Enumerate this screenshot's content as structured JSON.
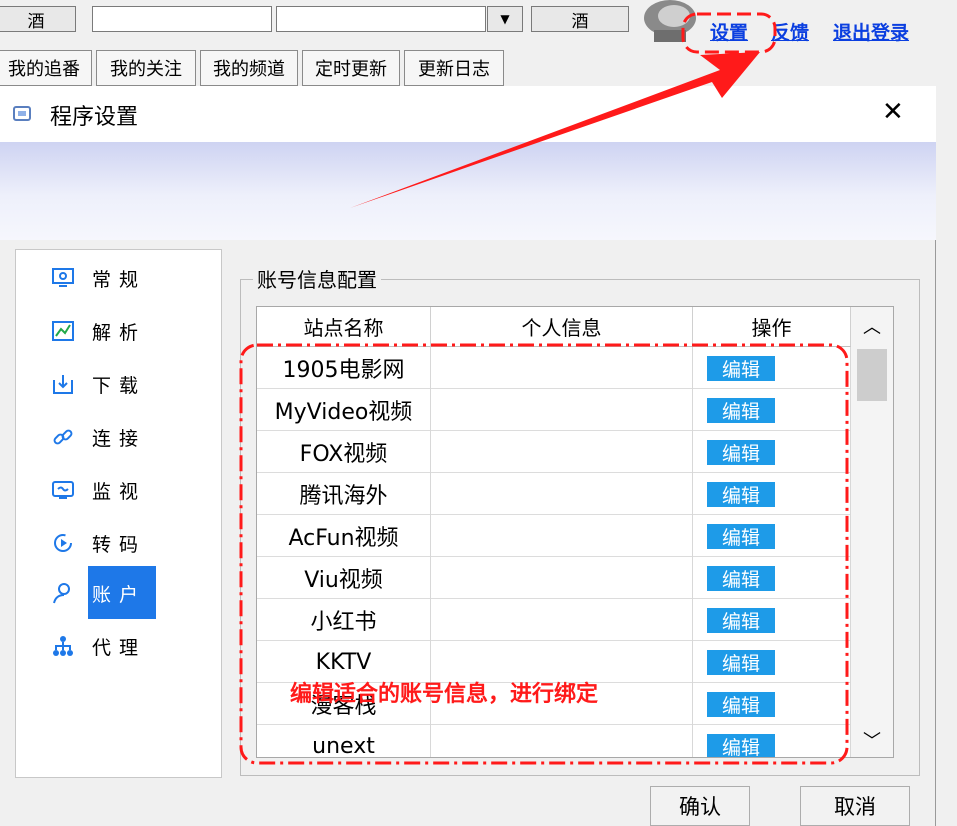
{
  "topbar": {
    "btn_left": "酒",
    "btn_right": "酒",
    "links": [
      "设置",
      "反馈",
      "退出登录"
    ]
  },
  "tabs": [
    "我的追番",
    "我的关注",
    "我的频道",
    "定时更新",
    "更新日志"
  ],
  "dialog": {
    "title": "程序设置",
    "close_glyph": "✕",
    "nav": [
      {
        "label": "常规",
        "icon": "monitor-settings-icon"
      },
      {
        "label": "解析",
        "icon": "chart-icon"
      },
      {
        "label": "下载",
        "icon": "download-icon"
      },
      {
        "label": "连接",
        "icon": "link-icon"
      },
      {
        "label": "监视",
        "icon": "screen-monitor-icon"
      },
      {
        "label": "转码",
        "icon": "convert-icon"
      },
      {
        "label": "账户",
        "icon": "user-icon",
        "selected": true
      },
      {
        "label": "代理",
        "icon": "network-icon"
      }
    ],
    "group_label": "账号信息配置",
    "table": {
      "headers": [
        "站点名称",
        "个人信息",
        "操作"
      ],
      "rows": [
        {
          "site": "1905电影网",
          "info": "",
          "action": "编辑"
        },
        {
          "site": "MyVideo视频",
          "info": "",
          "action": "编辑"
        },
        {
          "site": "FOX视频",
          "info": "",
          "action": "编辑"
        },
        {
          "site": "腾讯海外",
          "info": "",
          "action": "编辑"
        },
        {
          "site": "AcFun视频",
          "info": "",
          "action": "编辑"
        },
        {
          "site": "Viu视频",
          "info": "",
          "action": "编辑"
        },
        {
          "site": "小红书",
          "info": "",
          "action": "编辑"
        },
        {
          "site": "KKTV",
          "info": "",
          "action": "编辑"
        },
        {
          "site": "漫客栈",
          "info": "",
          "action": "编辑"
        },
        {
          "site": "unext",
          "info": "",
          "action": "编辑"
        }
      ]
    },
    "confirm_label": "确认",
    "cancel_label": "取消"
  },
  "annotation": {
    "text": "编辑适合的账号信息，进行绑定",
    "color": "#ff1a1a"
  },
  "colors": {
    "link": "#0b3fe0",
    "edit_button": "#1e9be8",
    "selected_nav": "#1e78e8",
    "annotation_red": "#ff1a1a"
  }
}
